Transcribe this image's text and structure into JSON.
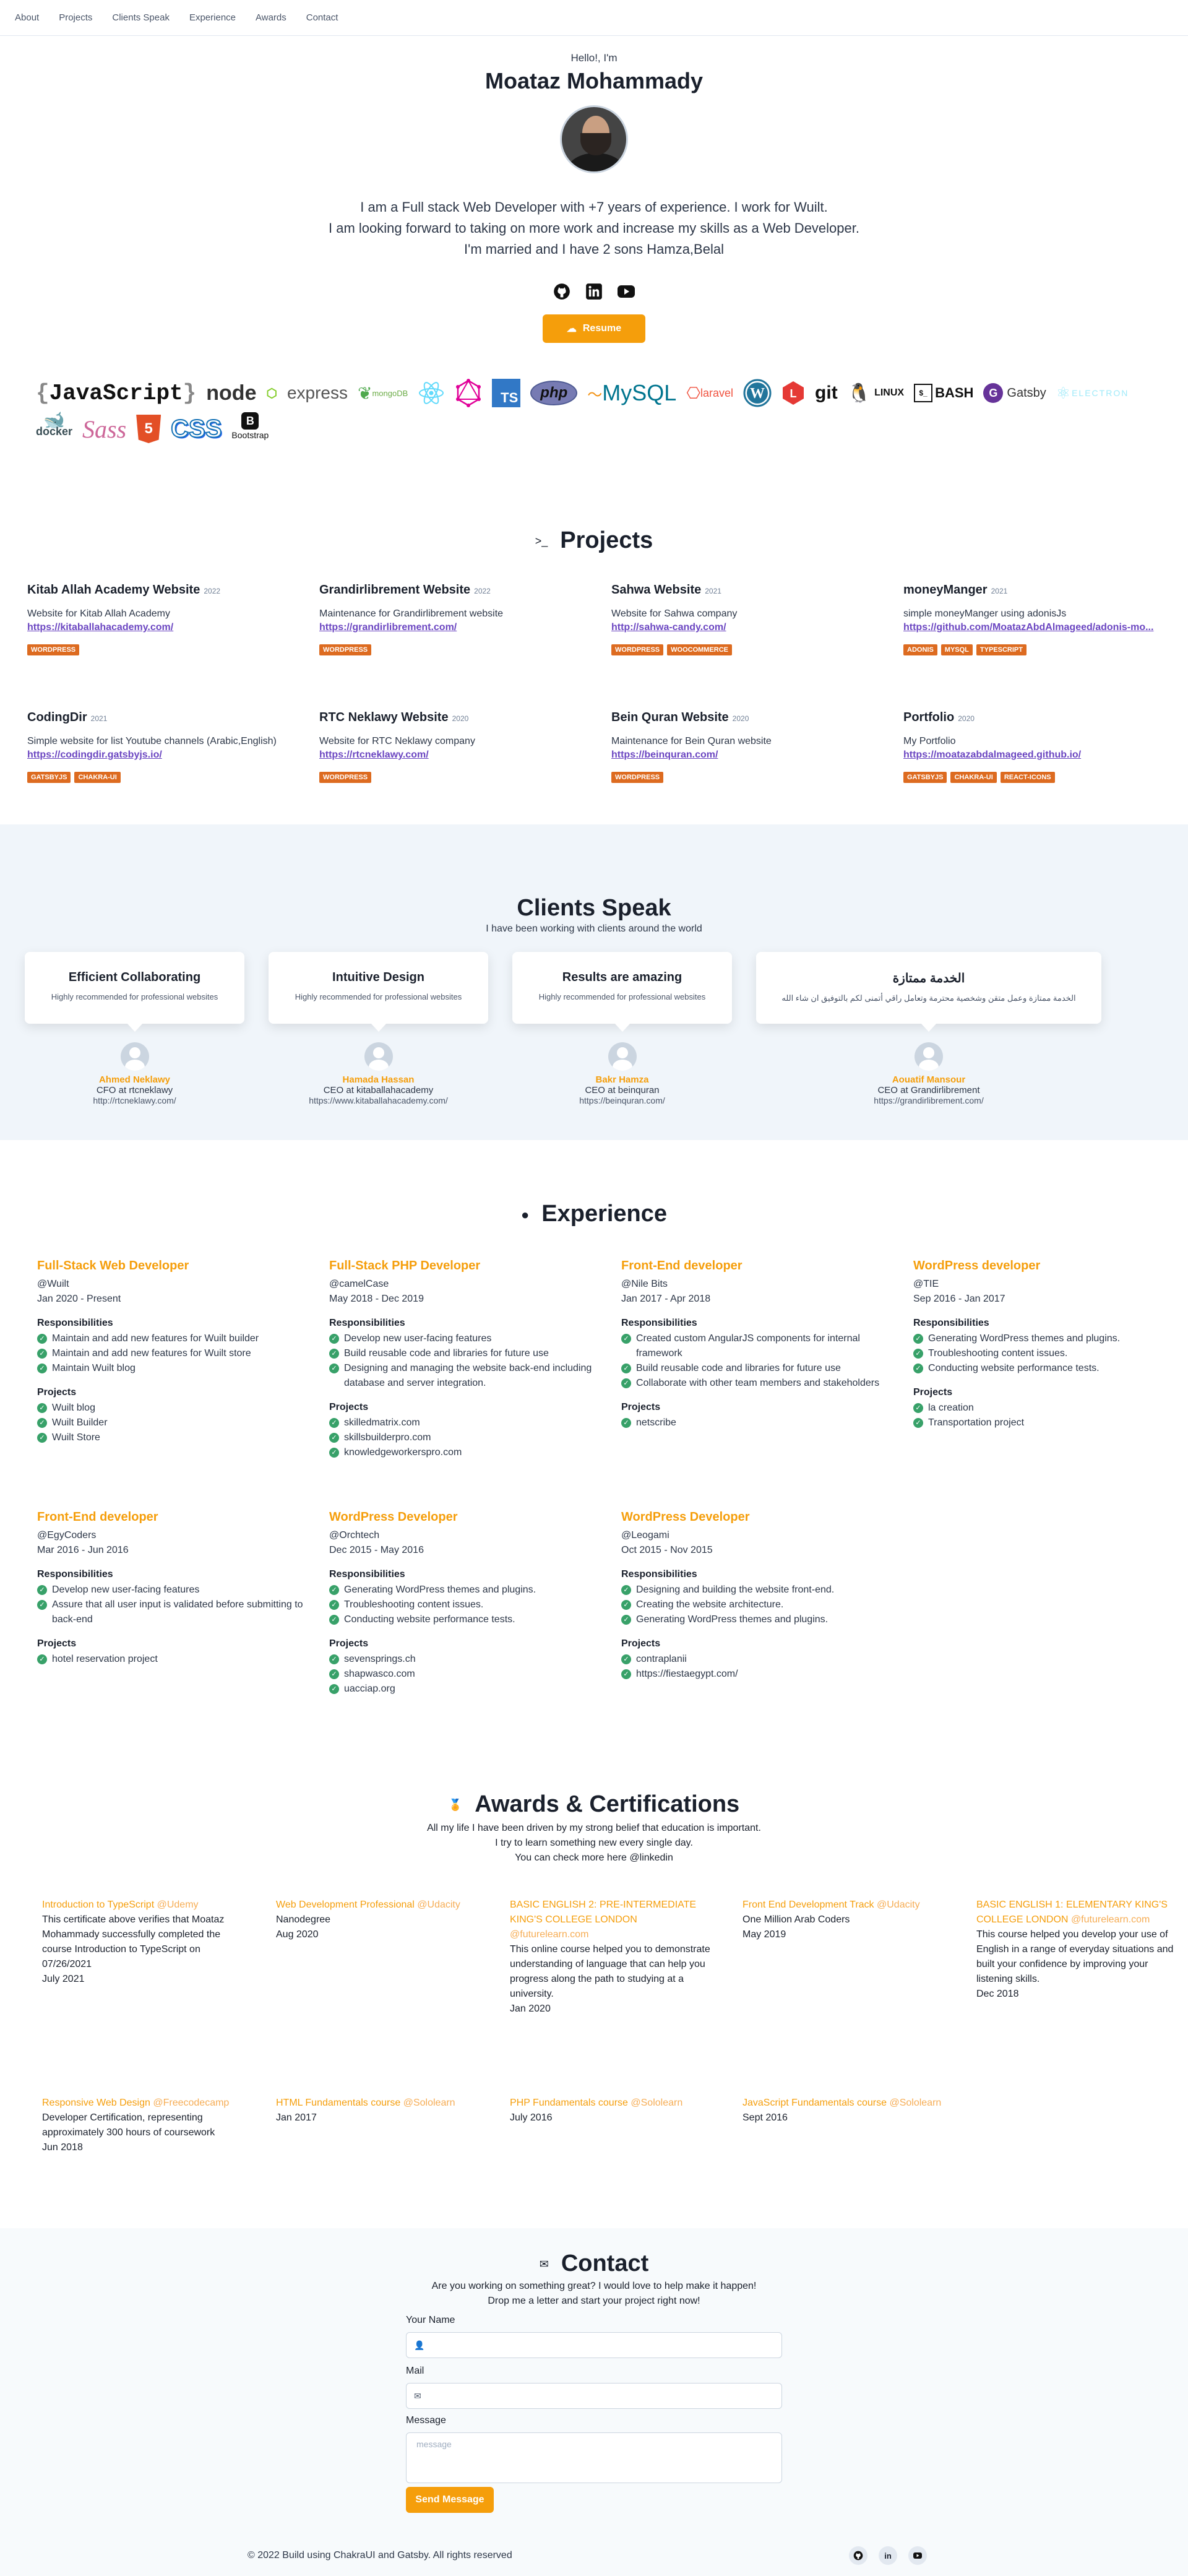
{
  "nav": {
    "items": [
      "About",
      "Projects",
      "Clients Speak",
      "Experience",
      "Awards",
      "Contact"
    ]
  },
  "hero": {
    "hello": "Hello!, I'm",
    "name": "Moataz Mohammady",
    "bio": [
      "I am a Full stack Web Developer with +7 years of experience. I work for Wuilt.",
      "I am looking forward to taking on more work and increase my skills as a Web Developer.",
      "I'm married and I have 2 sons Hamza,Belal"
    ],
    "resume": "Resume"
  },
  "tech": [
    "JavaScript",
    "node",
    "express",
    "mongoDB",
    "React",
    "GraphQL",
    "TS",
    "php",
    "MySQL",
    "laravel",
    "WordPress",
    "Laravel",
    "git",
    "LINUX",
    "BASH",
    "Gatsby",
    "ELECTRON",
    "docker",
    "Sass",
    "5",
    "CSS",
    "Bootstrap"
  ],
  "projects": {
    "title": "Projects",
    "items": [
      {
        "name": "Kitab Allah Academy Website",
        "year": "2022",
        "desc": "Website for Kitab Allah Academy",
        "link": "https://kitaballahacademy.com/",
        "tags": [
          "WORDPRESS"
        ]
      },
      {
        "name": "Grandirlibrement Website",
        "year": "2022",
        "desc": "Maintenance for Grandirlibrement website",
        "link": "https://grandirlibrement.com/",
        "tags": [
          "WORDPRESS"
        ]
      },
      {
        "name": "Sahwa Website",
        "year": "2021",
        "desc": "Website for Sahwa company",
        "link": "http://sahwa-candy.com/",
        "tags": [
          "WORDPRESS",
          "WOOCOMMERCE"
        ]
      },
      {
        "name": "moneyManger",
        "year": "2021",
        "desc": "simple moneyManger using adonisJs",
        "link": "https://github.com/MoatazAbdAlmageed/adonis-mo...",
        "tags": [
          "ADONIS",
          "MYSQL",
          "TYPESCRIPT"
        ]
      },
      {
        "name": "CodingDir",
        "year": "2021",
        "desc": "Simple website for list Youtube channels (Arabic,English)",
        "link": "https://codingdir.gatsbyjs.io/",
        "tags": [
          "GATSBYJS",
          "CHAKRA-UI"
        ]
      },
      {
        "name": "RTC Neklawy Website",
        "year": "2020",
        "desc": "Website for RTC Neklawy company",
        "link": "https://rtcneklawy.com/",
        "tags": [
          "WORDPRESS"
        ]
      },
      {
        "name": "Bein Quran Website",
        "year": "2020",
        "desc": "Maintenance for Bein Quran website",
        "link": "https://beinquran.com/",
        "tags": [
          "WORDPRESS"
        ]
      },
      {
        "name": "Portfolio",
        "year": "2020",
        "desc": "My Portfolio",
        "link": "https://moatazabdalmageed.github.io/",
        "tags": [
          "GATSBYJS",
          "CHAKRA-UI",
          "REACT-ICONS"
        ]
      }
    ]
  },
  "clients": {
    "title": "Clients Speak",
    "subtitle": "I have been working with clients around the world",
    "items": [
      {
        "heading": "Efficient Collaborating",
        "text": "Highly recommended for professional websites",
        "name": "Ahmed Neklawy",
        "role": "CFO at rtcneklawy",
        "url": "http://rtcneklawy.com/"
      },
      {
        "heading": "Intuitive Design",
        "text": "Highly recommended for professional websites",
        "name": "Hamada Hassan",
        "role": "CEO at kitaballahacademy",
        "url": "https://www.kitaballahacademy.com/"
      },
      {
        "heading": "Results are amazing",
        "text": "Highly recommended for professional websites",
        "name": "Bakr Hamza",
        "role": "CEO at beinquran",
        "url": "https://beinquran.com/"
      },
      {
        "heading": "الخدمة ممتازة",
        "text": "الخدمة ممتازة وعمل متقن وشخصية محترمة وتعامل راقي أتمنى لكم بالتوفيق ان شاء الله",
        "name": "Aouatif Mansour",
        "role": "CEO at Grandirlibrement",
        "url": "https://grandirlibrement.com/"
      }
    ]
  },
  "experience": {
    "title": "Experience",
    "items": [
      {
        "role": "Full-Stack Web Developer",
        "company": "@Wuilt",
        "dates": "Jan 2020 - Present",
        "resp": [
          "Maintain and add new features for Wuilt builder",
          "Maintain and add new features for Wuilt store",
          "Maintain Wuilt blog"
        ],
        "projects": [
          "Wuilt blog",
          "Wuilt Builder",
          "Wuilt Store"
        ]
      },
      {
        "role": "Full-Stack PHP Developer",
        "company": "@camelCase",
        "dates": "May 2018 - Dec 2019",
        "resp": [
          "Develop new user-facing features",
          "Build reusable code and libraries for future use",
          "Designing and managing the website back-end including database and server integration."
        ],
        "projects": [
          "skilledmatrix.com",
          "skillsbuilderpro.com",
          "knowledgeworkerspro.com"
        ]
      },
      {
        "role": "Front-End developer",
        "company": "@Nile Bits",
        "dates": "Jan 2017 - Apr 2018",
        "resp": [
          "Created custom AngularJS components for internal framework",
          "Build reusable code and libraries for future use",
          "Collaborate with other team members and stakeholders"
        ],
        "projects": [
          "netscribe"
        ]
      },
      {
        "role": "WordPress developer",
        "company": "@TIE",
        "dates": "Sep 2016 - Jan 2017",
        "resp": [
          "Generating WordPress themes and plugins.",
          "Troubleshooting content issues.",
          "Conducting website performance tests."
        ],
        "projects": [
          "la creation",
          "Transportation project"
        ]
      },
      {
        "role": "Front-End developer",
        "company": "@EgyCoders",
        "dates": "Mar 2016 - Jun 2016",
        "resp": [
          "Develop new user-facing features",
          "Assure that all user input is validated before submitting to back-end"
        ],
        "projects": [
          "hotel reservation project"
        ]
      },
      {
        "role": "WordPress Developer",
        "company": "@Orchtech",
        "dates": "Dec 2015 - May 2016",
        "resp": [
          "Generating WordPress themes and plugins.",
          "Troubleshooting content issues.",
          "Conducting website performance tests."
        ],
        "projects": [
          "sevensprings.ch",
          "shapwasco.com",
          "uacciap.org"
        ]
      },
      {
        "role": "WordPress Developer",
        "company": "@Leogami",
        "dates": "Oct 2015 - Nov 2015",
        "resp": [
          "Designing and building the website front-end.",
          "Creating the website architecture.",
          "Generating WordPress themes and plugins."
        ],
        "projects": [
          "contraplanii",
          "https://fiestaegypt.com/"
        ]
      }
    ],
    "resp_label": "Responsibilities",
    "proj_label": "Projects"
  },
  "awards": {
    "title": "Awards & Certifications",
    "intro": [
      "All my life I have been driven by my strong belief that education is important.",
      "I try to learn something new every single day.",
      "You can check more here @linkedin"
    ],
    "items": [
      {
        "title": "Introduction to TypeScript",
        "issuer": "@Udemy",
        "desc": "This certificate above verifies that Moataz Mohammady successfully completed the course Introduction to TypeScript on 07/26/2021",
        "date": "July 2021"
      },
      {
        "title": "Web Development Professional",
        "issuer": "@Udacity",
        "desc": "Nanodegree",
        "date": "Aug 2020"
      },
      {
        "title": "BASIC ENGLISH 2: PRE-INTERMEDIATE KING'S COLLEGE LONDON",
        "issuer": "@futurelearn.com",
        "desc": "This online course helped you to demonstrate understanding of language that can help you progress along the path to studying at a university.",
        "date": "Jan 2020"
      },
      {
        "title": "Front End Development Track",
        "issuer": "@Udacity",
        "desc": "One Million Arab Coders",
        "date": "May 2019"
      },
      {
        "title": "BASIC ENGLISH 1: ELEMENTARY KING'S COLLEGE LONDON",
        "issuer": "@futurelearn.com",
        "desc": "This course helped you develop your use of English in a range of everyday situations and built your confidence by improving your listening skills.",
        "date": "Dec 2018"
      },
      {
        "title": "Responsive Web Design",
        "issuer": "@Freecodecamp",
        "desc": "Developer Certification, representing approximately 300 hours of coursework",
        "date": "Jun 2018"
      },
      {
        "title": "HTML Fundamentals course",
        "issuer": "@Sololearn",
        "desc": "",
        "date": "Jan 2017"
      },
      {
        "title": "PHP Fundamentals course",
        "issuer": "@Sololearn",
        "desc": "",
        "date": "July 2016"
      },
      {
        "title": "JavaScript Fundamentals course",
        "issuer": "@Sololearn",
        "desc": "",
        "date": "Sept 2016"
      }
    ]
  },
  "contact": {
    "title": "Contact",
    "sub1": "Are you working on something great? I would love to help make it happen!",
    "sub2": "Drop me a letter and start your project right now!",
    "name_label": "Your Name",
    "mail_label": "Mail",
    "message_label": "Message",
    "message_placeholder": "message",
    "send": "Send Message"
  },
  "footer": {
    "text": "© 2022 Build using ChakraUI and Gatsby. All rights reserved"
  },
  "colors": {
    "accent": "#f59e0b",
    "tag": "#dd6b20",
    "link": "#6b46c1",
    "check": "#38a169",
    "clients_bg": "#f0f5fa"
  }
}
